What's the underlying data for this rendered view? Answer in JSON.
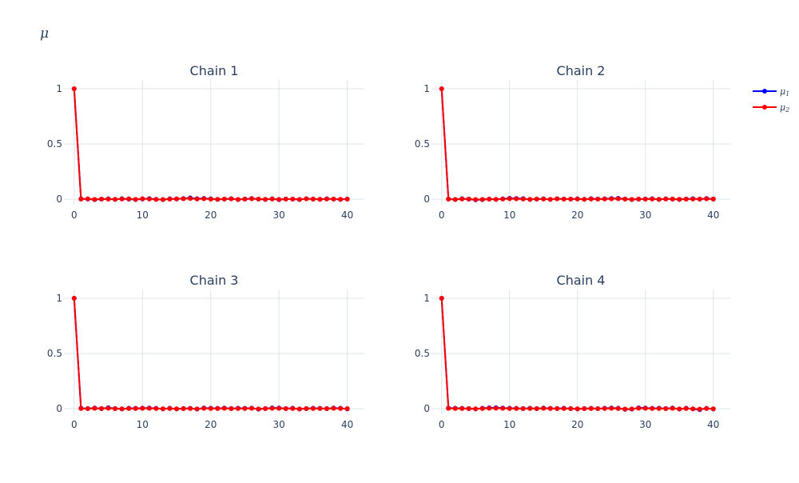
{
  "figure": {
    "title": "μ"
  },
  "legend": {
    "items": [
      {
        "label": "μ",
        "sub": "1",
        "color": "#0000ff"
      },
      {
        "label": "μ",
        "sub": "2",
        "color": "#ff0000"
      }
    ]
  },
  "chart_data": [
    {
      "type": "line",
      "title": "Chain 1",
      "x": [
        0,
        1,
        2,
        3,
        4,
        5,
        6,
        7,
        8,
        9,
        10,
        11,
        12,
        13,
        14,
        15,
        16,
        17,
        18,
        19,
        20,
        21,
        22,
        23,
        24,
        25,
        26,
        27,
        28,
        29,
        30,
        31,
        32,
        33,
        34,
        35,
        36,
        37,
        38,
        39,
        40
      ],
      "xlim": [
        -1.5,
        42.5
      ],
      "ylim": [
        -0.05,
        1.08
      ],
      "xticks": [
        0,
        10,
        20,
        30,
        40
      ],
      "yticks": [
        0,
        0.5,
        1
      ],
      "xtick_labels": [
        "0",
        "10",
        "20",
        "30",
        "40"
      ],
      "ytick_labels": [
        "0",
        "0.5",
        "1"
      ],
      "series": [
        {
          "name": "μ1",
          "color": "#0000ff",
          "values": [
            1,
            0.003,
            0.002,
            -0.004,
            0.001,
            0.003,
            -0.002,
            0.004,
            0.001,
            -0.003,
            0.002,
            0.005,
            -0.001,
            -0.004,
            0.003,
            0.002,
            0.006,
            0.012,
            0.004,
            0.007,
            0.003,
            -0.002,
            0.001,
            0.004,
            -0.003,
            0.002,
            0.006,
            0.001,
            -0.002,
            0.003,
            -0.004,
            0.002,
            0.001,
            -0.003,
            0.004,
            0.002,
            -0.001,
            0.003,
            0.001,
            -0.002,
            0.002
          ]
        },
        {
          "name": "μ2",
          "color": "#ff0000",
          "values": [
            1,
            0.001,
            0.003,
            -0.002,
            0.002,
            0.001,
            -0.001,
            0.002,
            0.003,
            -0.002,
            0.004,
            0.002,
            -0.002,
            -0.003,
            0.001,
            0.003,
            0.004,
            0.006,
            0.002,
            0.004,
            0.001,
            -0.001,
            0.002,
            0.003,
            -0.002,
            0.001,
            0.004,
            0.002,
            -0.001,
            0.002,
            -0.002,
            0.001,
            0.002,
            -0.002,
            0.003,
            0.001,
            -0.001,
            0.002,
            0.002,
            -0.001,
            0.001
          ]
        }
      ]
    },
    {
      "type": "line",
      "title": "Chain 2",
      "x": [
        0,
        1,
        2,
        3,
        4,
        5,
        6,
        7,
        8,
        9,
        10,
        11,
        12,
        13,
        14,
        15,
        16,
        17,
        18,
        19,
        20,
        21,
        22,
        23,
        24,
        25,
        26,
        27,
        28,
        29,
        30,
        31,
        32,
        33,
        34,
        35,
        36,
        37,
        38,
        39,
        40
      ],
      "xlim": [
        -1.5,
        42.5
      ],
      "ylim": [
        -0.05,
        1.08
      ],
      "xticks": [
        0,
        10,
        20,
        30,
        40
      ],
      "yticks": [
        0,
        0.5,
        1
      ],
      "xtick_labels": [
        "0",
        "10",
        "20",
        "30",
        "40"
      ],
      "ytick_labels": [
        "0",
        "0.5",
        "1"
      ],
      "series": [
        {
          "name": "μ1",
          "color": "#0000ff",
          "values": [
            1,
            0.002,
            -0.003,
            0.004,
            0.001,
            -0.006,
            -0.004,
            0.002,
            -0.002,
            0.003,
            0.008,
            0.006,
            0.005,
            -0.002,
            0.001,
            0.003,
            -0.002,
            0.004,
            0.002,
            0.001,
            0.003,
            -0.001,
            0.004,
            0.002,
            0.003,
            0.006,
            0.008,
            0.002,
            -0.003,
            0.001,
            0.002,
            0.004,
            -0.002,
            0.003,
            0.001,
            -0.002,
            0.002,
            0.004,
            0.001,
            0.006,
            0.002
          ]
        },
        {
          "name": "μ2",
          "color": "#ff0000",
          "values": [
            1,
            0.001,
            -0.002,
            0.002,
            0.002,
            -0.003,
            -0.002,
            0.001,
            -0.001,
            0.002,
            0.004,
            0.003,
            0.002,
            -0.001,
            0.002,
            0.002,
            -0.001,
            0.003,
            0.001,
            0.002,
            0.002,
            -0.001,
            0.002,
            0.001,
            0.002,
            0.003,
            0.004,
            0.001,
            -0.002,
            0.002,
            0.001,
            0.002,
            -0.001,
            0.002,
            0.002,
            -0.001,
            0.001,
            0.002,
            0.002,
            0.003,
            0.001
          ]
        }
      ]
    },
    {
      "type": "line",
      "title": "Chain 3",
      "x": [
        0,
        1,
        2,
        3,
        4,
        5,
        6,
        7,
        8,
        9,
        10,
        11,
        12,
        13,
        14,
        15,
        16,
        17,
        18,
        19,
        20,
        21,
        22,
        23,
        24,
        25,
        26,
        27,
        28,
        29,
        30,
        31,
        32,
        33,
        34,
        35,
        36,
        37,
        38,
        39,
        40
      ],
      "xlim": [
        -1.5,
        42.5
      ],
      "ylim": [
        -0.05,
        1.08
      ],
      "xticks": [
        0,
        10,
        20,
        30,
        40
      ],
      "yticks": [
        0,
        0.5,
        1
      ],
      "xtick_labels": [
        "0",
        "10",
        "20",
        "30",
        "40"
      ],
      "ytick_labels": [
        "0",
        "0.5",
        "1"
      ],
      "series": [
        {
          "name": "μ1",
          "color": "#0000ff",
          "values": [
            1,
            0.004,
            0.002,
            0.006,
            0.001,
            0.009,
            0.002,
            -0.002,
            0.004,
            0.003,
            0.005,
            0.006,
            0.003,
            -0.001,
            0.004,
            -0.002,
            0.002,
            0.003,
            -0.003,
            0.006,
            0.004,
            0.003,
            0.006,
            0.002,
            0.004,
            0.003,
            0.005,
            -0.004,
            0.002,
            0.007,
            0.006,
            0.002,
            0.004,
            -0.003,
            0.002,
            0.004,
            0.003,
            0.001,
            0.006,
            0.004,
            -0.002
          ]
        },
        {
          "name": "μ2",
          "color": "#ff0000",
          "values": [
            1,
            0.002,
            0.001,
            0.003,
            0.002,
            0.004,
            0.001,
            -0.001,
            0.002,
            0.002,
            0.003,
            0.003,
            0.002,
            -0.001,
            0.002,
            -0.001,
            0.001,
            0.002,
            -0.002,
            0.003,
            0.002,
            0.002,
            0.003,
            0.001,
            0.002,
            0.002,
            0.003,
            -0.002,
            0.001,
            0.003,
            0.003,
            0.001,
            0.002,
            -0.002,
            0.001,
            0.002,
            0.002,
            0.001,
            0.003,
            0.002,
            0.001
          ]
        }
      ]
    },
    {
      "type": "line",
      "title": "Chain 4",
      "x": [
        0,
        1,
        2,
        3,
        4,
        5,
        6,
        7,
        8,
        9,
        10,
        11,
        12,
        13,
        14,
        15,
        16,
        17,
        18,
        19,
        20,
        21,
        22,
        23,
        24,
        25,
        26,
        27,
        28,
        29,
        30,
        31,
        32,
        33,
        34,
        35,
        36,
        37,
        38,
        39,
        40
      ],
      "xlim": [
        -1.5,
        42.5
      ],
      "ylim": [
        -0.05,
        1.08
      ],
      "xticks": [
        0,
        10,
        20,
        30,
        40
      ],
      "yticks": [
        0,
        0.5,
        1
      ],
      "xtick_labels": [
        "0",
        "10",
        "20",
        "30",
        "40"
      ],
      "ytick_labels": [
        "0",
        "0.5",
        "1"
      ],
      "series": [
        {
          "name": "μ1",
          "color": "#0000ff",
          "values": [
            1,
            0.006,
            0.004,
            0.003,
            0.002,
            -0.002,
            0.004,
            0.008,
            0.009,
            0.006,
            0.004,
            0.003,
            0.002,
            0.004,
            0.001,
            0.006,
            0.003,
            0.002,
            0.004,
            0.001,
            -0.002,
            0.002,
            0.003,
            0.001,
            0.004,
            0.006,
            0.004,
            -0.006,
            -0.004,
            0.008,
            0.006,
            0.003,
            0.004,
            0.002,
            0.006,
            -0.003,
            0.004,
            -0.002,
            -0.008,
            0.003,
            -0.002
          ]
        },
        {
          "name": "μ2",
          "color": "#ff0000",
          "values": [
            1,
            0.003,
            0.002,
            0.002,
            0.001,
            -0.001,
            0.002,
            0.004,
            0.004,
            0.003,
            0.002,
            0.002,
            0.001,
            0.002,
            0.001,
            0.003,
            0.002,
            0.001,
            0.002,
            0.001,
            -0.001,
            0.001,
            0.002,
            0.001,
            0.002,
            0.003,
            0.002,
            -0.003,
            -0.002,
            0.004,
            0.003,
            0.002,
            0.002,
            0.001,
            0.003,
            -0.002,
            0.002,
            -0.001,
            -0.004,
            0.002,
            -0.001
          ]
        }
      ]
    }
  ]
}
